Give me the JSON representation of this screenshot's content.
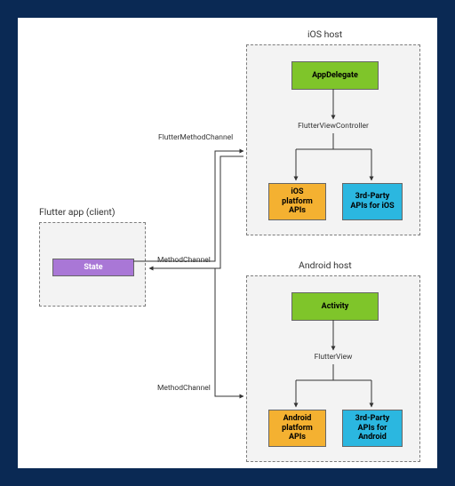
{
  "titles": {
    "ios_host": "iOS host",
    "android_host": "Android host",
    "flutter_client": "Flutter app (client)"
  },
  "nodes": {
    "app_delegate": "AppDelegate",
    "activity": "Activity",
    "state": "State",
    "ios_platform_apis": "iOS\nplatform\nAPIs",
    "ios_third_party": "3rd-Party\nAPIs for iOS",
    "android_platform_apis": "Android\nplatform\nAPIs",
    "android_third_party": "3rd-Party\nAPIs for\nAndroid"
  },
  "labels": {
    "flutter_view_controller": "FlutterViewController",
    "flutter_view": "FlutterView",
    "flutter_method_channel": "FlutterMethodChannel",
    "method_channel_ios": "MethodChannel",
    "method_channel_android": "MethodChannel"
  }
}
